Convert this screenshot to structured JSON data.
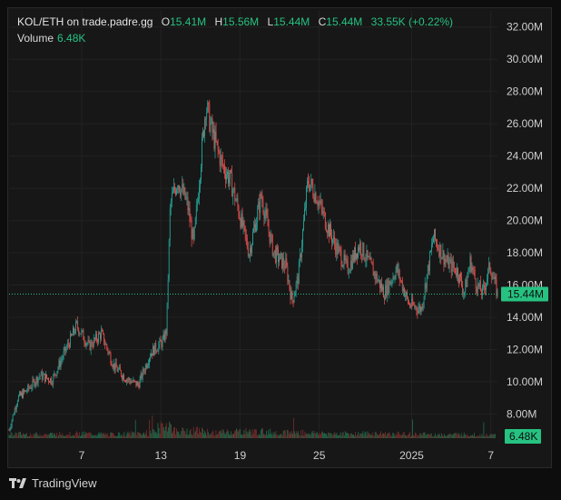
{
  "header": {
    "symbol": "KOL/ETH on trade.padre.gg",
    "open_label": "O",
    "open": "15.41M",
    "high_label": "H",
    "high": "15.56M",
    "low_label": "L",
    "low": "15.44M",
    "close_label": "C",
    "close": "15.44M",
    "change": "33.55K (+0.22%)"
  },
  "volume": {
    "label": "Volume",
    "value": "6.48K"
  },
  "footer": {
    "brand": "TradingView"
  },
  "colors": {
    "up": "#26a69a",
    "down": "#ef5350",
    "accent_green": "#26c281",
    "background": "#171717",
    "grid": "#222222",
    "last_price_label_bg": "#26c281"
  },
  "chart_data": {
    "type": "candlestick",
    "price_axis": {
      "ticks": [
        "32.00M",
        "30.00M",
        "28.00M",
        "26.00M",
        "24.00M",
        "22.00M",
        "20.00M",
        "18.00M",
        "16.00M",
        "14.00M",
        "12.00M",
        "10.00M",
        "8.00M"
      ],
      "tick_values": [
        32,
        30,
        28,
        26,
        24,
        22,
        20,
        18,
        16,
        14,
        12,
        10,
        8
      ],
      "unit": "M",
      "range": [
        6.5,
        33
      ]
    },
    "time_axis": {
      "ticks": [
        "7",
        "13",
        "19",
        "25",
        "2025",
        "7"
      ],
      "tick_positions_days": [
        6,
        12,
        18,
        24,
        31,
        37
      ],
      "range_days": [
        0.5,
        37.5
      ]
    },
    "last_price": {
      "value": 15.44,
      "label": "15.44M"
    },
    "volume_label": {
      "label": "6.48K"
    },
    "price_path": [
      [
        0.5,
        7.0
      ],
      [
        1.2,
        9.0
      ],
      [
        2,
        9.5
      ],
      [
        3,
        10.4
      ],
      [
        4,
        10.1
      ],
      [
        5,
        11.8
      ],
      [
        6,
        13.5
      ],
      [
        7,
        12.2
      ],
      [
        8,
        13.0
      ],
      [
        9,
        11.0
      ],
      [
        10,
        10.2
      ],
      [
        11,
        9.8
      ],
      [
        12,
        11.8
      ],
      [
        13,
        12.5
      ],
      [
        13.3,
        13.2
      ],
      [
        13.6,
        21.0
      ],
      [
        14.2,
        22.5
      ],
      [
        15,
        21.0
      ],
      [
        15.5,
        18.5
      ],
      [
        16,
        23.0
      ],
      [
        16.5,
        27.2
      ],
      [
        17,
        25.5
      ],
      [
        17.8,
        23.5
      ],
      [
        18.5,
        22.5
      ],
      [
        19.2,
        20.5
      ],
      [
        20,
        18.0
      ],
      [
        21,
        21.5
      ],
      [
        22,
        18.0
      ],
      [
        23,
        17.2
      ],
      [
        23.5,
        15.0
      ],
      [
        24,
        16.5
      ],
      [
        24.8,
        22.5
      ],
      [
        25.5,
        21.5
      ],
      [
        26.2,
        20.0
      ],
      [
        27,
        18.5
      ],
      [
        28,
        17.0
      ],
      [
        29,
        18.5
      ],
      [
        30,
        17.0
      ],
      [
        31,
        15.5
      ],
      [
        32,
        17.0
      ],
      [
        33,
        14.8
      ],
      [
        34,
        14.5
      ],
      [
        35,
        19.0
      ],
      [
        36,
        17.5
      ],
      [
        37,
        16.8
      ],
      [
        37.5,
        15.5
      ],
      [
        38,
        17.5
      ],
      [
        38.5,
        16.0
      ],
      [
        39,
        15.5
      ],
      [
        39.6,
        17.2
      ],
      [
        40.2,
        15.44
      ]
    ],
    "time_path_note": "",
    "volume_path": [
      [
        0.5,
        0.3
      ],
      [
        3,
        0.25
      ],
      [
        6,
        0.3
      ],
      [
        9,
        0.25
      ],
      [
        12,
        0.35
      ],
      [
        13.4,
        1.0
      ],
      [
        14,
        0.45
      ],
      [
        16,
        0.5
      ],
      [
        17,
        0.35
      ],
      [
        19,
        0.45
      ],
      [
        22,
        0.4
      ],
      [
        25,
        0.35
      ],
      [
        28,
        0.3
      ],
      [
        31,
        0.3
      ],
      [
        34,
        0.25
      ],
      [
        37,
        0.25
      ],
      [
        40,
        0.2
      ]
    ]
  }
}
